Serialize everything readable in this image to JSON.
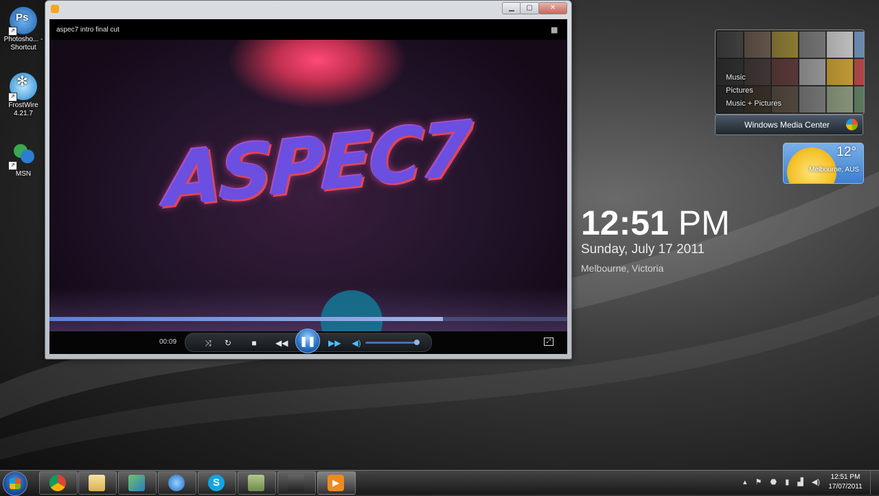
{
  "desktop": {
    "icons": [
      {
        "label": "Photosho... - Shortcut",
        "icon": "photoshop-icon",
        "color": "#2a7fd6"
      },
      {
        "label": "FrostWire 4.21.7",
        "icon": "frostwire-icon",
        "color": "#1f8ad1"
      },
      {
        "label": "MSN",
        "icon": "msn-icon",
        "color": "#2fa84f"
      }
    ]
  },
  "player": {
    "title": "aspec7 intro final cut",
    "video_text": "ASPEC7",
    "elapsed": "00:09",
    "progress_fraction": 0.76,
    "volume_fraction": 0.95,
    "accent": "#2a73c7"
  },
  "gadgets": {
    "media_center": {
      "menu": [
        "Music",
        "Pictures",
        "Music + Pictures"
      ],
      "label": "Windows Media Center"
    },
    "weather": {
      "temp": "12°",
      "location": "Melbourne, AUS"
    },
    "clock": {
      "hm": "12:51",
      "ampm": "PM",
      "date": "Sunday, July 17 2011",
      "location": "Melbourne, Victoria"
    }
  },
  "taskbar": {
    "apps": [
      "chrome",
      "explorer",
      "app-green",
      "itunes",
      "skype",
      "photos",
      "camcorder",
      "media-player"
    ],
    "time": "12:51 PM",
    "date": "17/07/2011"
  }
}
